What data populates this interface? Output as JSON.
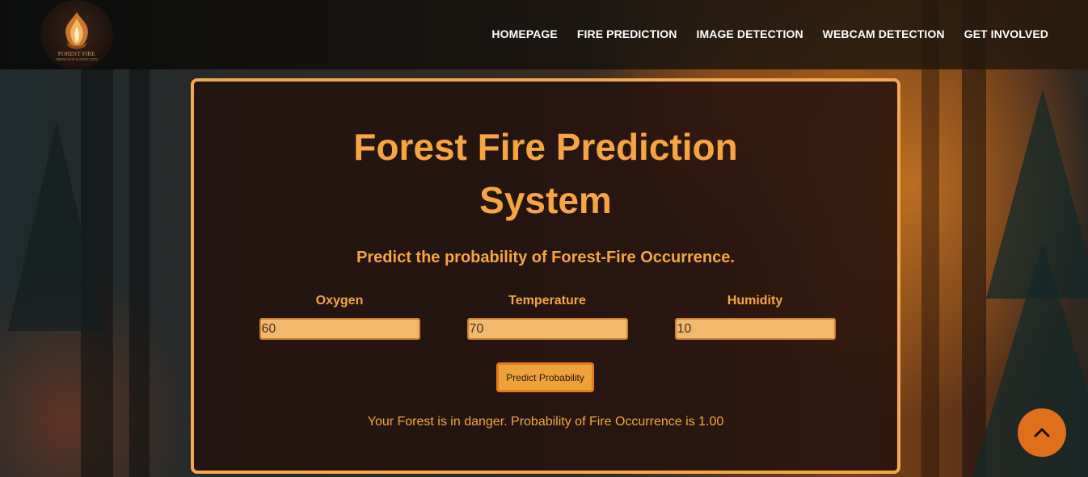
{
  "logo": {
    "name": "FOREST FIRE",
    "tagline": "PREDICTION & DETECTION"
  },
  "nav": {
    "items": [
      {
        "label": "HOMEPAGE"
      },
      {
        "label": "FIRE PREDICTION"
      },
      {
        "label": "IMAGE DETECTION"
      },
      {
        "label": "WEBCAM DETECTION"
      },
      {
        "label": "GET INVOLVED"
      }
    ]
  },
  "main": {
    "title": "Forest Fire Prediction System",
    "subtitle": "Predict the probability of Forest-Fire Occurrence.",
    "fields": [
      {
        "label": "Oxygen",
        "value": "60"
      },
      {
        "label": "Temperature",
        "value": "70"
      },
      {
        "label": "Humidity",
        "value": "10"
      }
    ],
    "button_label": "Predict Probability",
    "result": "Your Forest is in danger. Probability of Fire Occurrence is 1.00"
  },
  "scroll_top": {
    "icon": "chevron-up-icon"
  },
  "colors": {
    "accent": "#f5a542",
    "card_border": "#f3a94d",
    "input_bg": "#f2b86c",
    "button_bg": "#f0a23a",
    "scroll_button": "#e06f1c"
  }
}
